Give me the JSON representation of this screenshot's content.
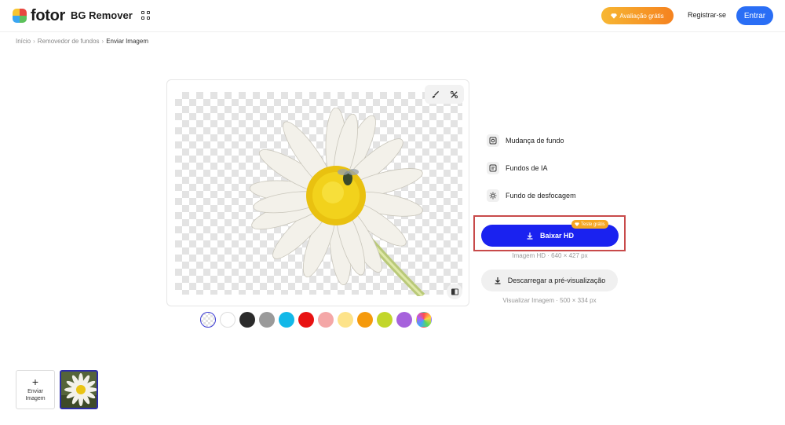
{
  "header": {
    "logo_text": "fotor",
    "product_name": "BG Remover",
    "trial_label": "Avaliação grátis",
    "register_label": "Registrar-se",
    "login_label": "Entrar"
  },
  "breadcrumb": [
    "Início",
    "Removedor de fundos",
    "Enviar Imagem"
  ],
  "tools": [
    "brush-icon",
    "magic-eraser-icon"
  ],
  "swatches": [
    "transparent",
    "#ffffff",
    "#2b2b2b",
    "#9a9a9a",
    "#12b8e8",
    "#e81212",
    "#f4a7a7",
    "#fde38a",
    "#f59a0c",
    "#c2d62a",
    "#a662dc",
    "rainbow"
  ],
  "options": [
    {
      "label": "Mudança de fundo",
      "icon": "change-background-icon"
    },
    {
      "label": "Fundos de IA",
      "icon": "ai-backgrounds-icon"
    },
    {
      "label": "Fundo de desfocagem",
      "icon": "blur-background-icon"
    }
  ],
  "download": {
    "hd_label": "Baixar HD",
    "free_badge": "Teste grátis",
    "hd_info": "Imagem HD · 640 × 427 px",
    "preview_label": "Descarregar a pré-visualização",
    "preview_info": "Visualizar Imagem · 500 × 334 px"
  },
  "uploads": {
    "upload_label": "Enviar Imagem"
  },
  "colors": {
    "accent": "#1a22f0",
    "login": "#2a6ef5",
    "highlight": "#c84a4a"
  }
}
